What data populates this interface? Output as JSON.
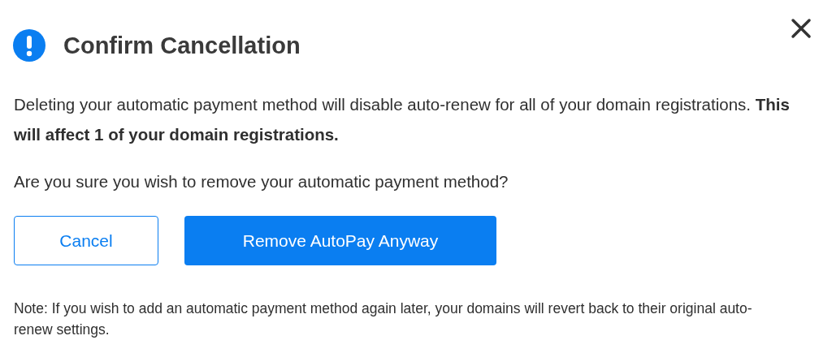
{
  "dialog": {
    "title": "Confirm Cancellation",
    "message": "Deleting your automatic payment method will disable auto-renew for all of your domain registrations. **This will affect 1 of your domain registrations.**",
    "question": "Are you sure you wish to remove your automatic payment method?",
    "buttons": [
      {
        "label": "Cancel",
        "kind": "secondary"
      },
      {
        "label": "Remove AutoPay Anyway",
        "kind": "primary"
      }
    ],
    "note": "Note: If you wish to add an automatic payment method again later, your domains will revert back to their original auto-renew settings."
  }
}
